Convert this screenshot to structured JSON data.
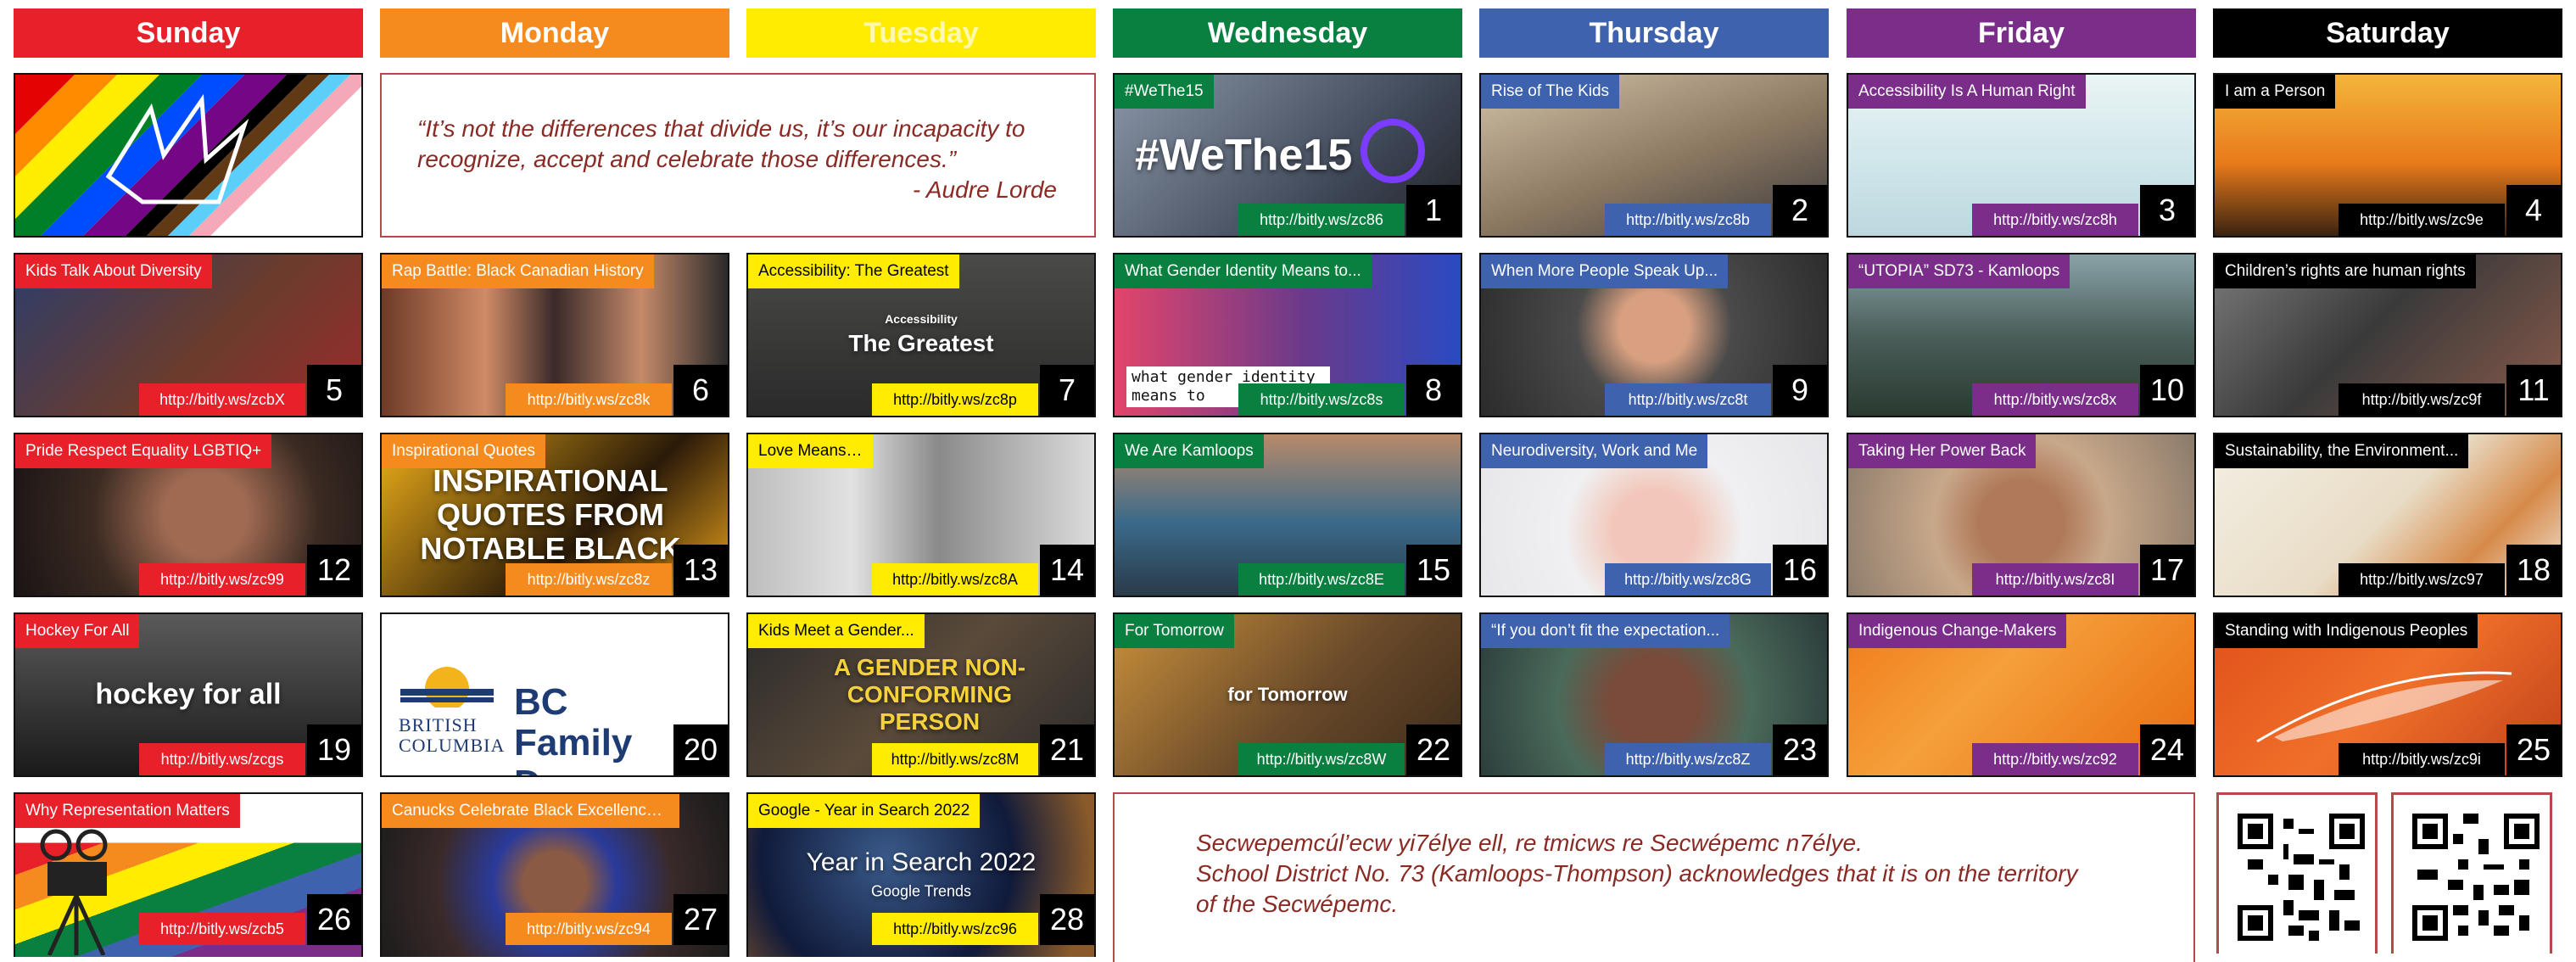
{
  "colors": {
    "sunday": "#e8202a",
    "monday": "#f58a1f",
    "tuesday": "#ffec00",
    "wednesday": "#0a8040",
    "thursday": "#3f62ae",
    "friday": "#7a2e8a",
    "saturday": "#000000",
    "quote_text": "#8a2a24"
  },
  "days": [
    "Sunday",
    "Monday",
    "Tuesday",
    "Wednesday",
    "Thursday",
    "Friday",
    "Saturday"
  ],
  "quote": {
    "text": "“It’s not the differences that divide us, it’s our incapacity to recognize, accept and celebrate those differences.”",
    "author": "- Audre Lorde"
  },
  "acknowledgement": {
    "line1": "Secwepemcúl’ecw yi7élye ell, re tmicws re Secwépemc n7élye.",
    "line2": "School District No. 73 (Kamloops-Thompson) acknowledges that it is on the territory",
    "line3": "of the Secwépemc."
  },
  "special_text": {
    "wethe15": "#WeThe15",
    "greatest_small": "Accessibility",
    "greatest": "The Greatest",
    "inspirational": "INSPIRATIONAL QUOTES FROM NOTABLE BLACK",
    "gender_overlay": "what gender identity means to",
    "hockey": "hockey for all",
    "bc_british": "BRITISH",
    "bc_columbia": "COLUMBIA",
    "bc_family": "BC Family Day",
    "gender_nonconf": "A GENDER NON-CONFORMING PERSON",
    "tomorrow": "for Tomorrow",
    "year_in_search": "Year in Search 2022",
    "google_trends": "Google Trends"
  },
  "cells": [
    {
      "title": "#WeThe15",
      "url": "http://bitly.ws/zc86",
      "num": "1"
    },
    {
      "title": "Rise of The Kids",
      "url": "http://bitly.ws/zc8b",
      "num": "2"
    },
    {
      "title": "Accessibility Is A Human Right",
      "url": "http://bitly.ws/zc8h",
      "num": "3"
    },
    {
      "title": "I am a Person",
      "url": "http://bitly.ws/zc9e",
      "num": "4"
    },
    {
      "title": "Kids Talk About Diversity",
      "url": "http://bitly.ws/zcbX",
      "num": "5"
    },
    {
      "title": "Rap Battle: Black Canadian History",
      "url": "http://bitly.ws/zc8k",
      "num": "6"
    },
    {
      "title": "Accessibility: The Greatest",
      "url": "http://bitly.ws/zc8p",
      "num": "7"
    },
    {
      "title": "What Gender Identity Means to...",
      "url": "http://bitly.ws/zc8s",
      "num": "8"
    },
    {
      "title": "When More People Speak Up...",
      "url": "http://bitly.ws/zc8t",
      "num": "9"
    },
    {
      "title": "“UTOPIA” SD73 - Kamloops",
      "url": "http://bitly.ws/zc8x",
      "num": "10"
    },
    {
      "title": "Children’s rights are human rights",
      "url": "http://bitly.ws/zc9f",
      "num": "11"
    },
    {
      "title": "Pride Respect Equality LGBTIQ+",
      "url": "http://bitly.ws/zc99",
      "num": "12"
    },
    {
      "title": "Inspirational Quotes",
      "url": "http://bitly.ws/zc8z",
      "num": "13"
    },
    {
      "title": "Love Means…",
      "url": "http://bitly.ws/zc8A",
      "num": "14"
    },
    {
      "title": "We Are Kamloops",
      "url": "http://bitly.ws/zc8E",
      "num": "15"
    },
    {
      "title": "Neurodiversity, Work and Me",
      "url": "http://bitly.ws/zc8G",
      "num": "16"
    },
    {
      "title": "Taking Her Power Back",
      "url": "http://bitly.ws/zc8I",
      "num": "17"
    },
    {
      "title": "Sustainability, the Environment...",
      "url": "http://bitly.ws/zc97",
      "num": "18"
    },
    {
      "title": "Hockey For All",
      "url": "http://bitly.ws/zcgs",
      "num": "19"
    },
    {
      "title": "",
      "url": "",
      "num": "20"
    },
    {
      "title": "Kids Meet a Gender...",
      "url": "http://bitly.ws/zc8M",
      "num": "21"
    },
    {
      "title": "For Tomorrow",
      "url": "http://bitly.ws/zc8W",
      "num": "22"
    },
    {
      "title": "“If you don’t fit the expectation...",
      "url": "http://bitly.ws/zc8Z",
      "num": "23"
    },
    {
      "title": "Indigenous Change-Makers",
      "url": "http://bitly.ws/zc92",
      "num": "24"
    },
    {
      "title": "Standing with Indigenous Peoples",
      "url": "http://bitly.ws/zc9i",
      "num": "25"
    },
    {
      "title": "Why Representation Matters",
      "url": "http://bitly.ws/zcb5",
      "num": "26"
    },
    {
      "title": "Canucks Celebrate Black Excellence Day",
      "url": "http://bitly.ws/zc94",
      "num": "27"
    },
    {
      "title": "Google - Year in Search 2022",
      "url": "http://bitly.ws/zc96",
      "num": "28"
    }
  ]
}
